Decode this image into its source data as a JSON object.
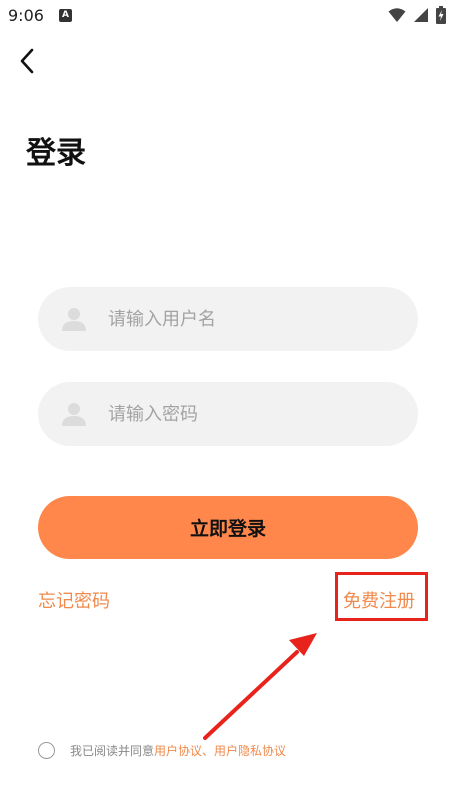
{
  "status_bar": {
    "time": "9:06",
    "notification_icon": "A"
  },
  "nav": {
    "back_icon": "chevron-left-icon"
  },
  "page": {
    "title": "登录"
  },
  "form": {
    "username_placeholder": "请输入用户名",
    "username_value": "",
    "password_placeholder": "请输入密码",
    "password_value": "",
    "login_label": "立即登录",
    "forgot_password": "忘记密码",
    "register": "免费注册"
  },
  "agreement": {
    "checked": false,
    "prefix": "我已阅读并同意 ",
    "user_agreement": "用户协议",
    "separator": "、",
    "privacy_agreement": "用户隐私协议"
  },
  "colors": {
    "accent": "#ff874b",
    "link": "#f08a4c",
    "annotation": "#e8231c",
    "input_bg": "#f2f2f2"
  }
}
